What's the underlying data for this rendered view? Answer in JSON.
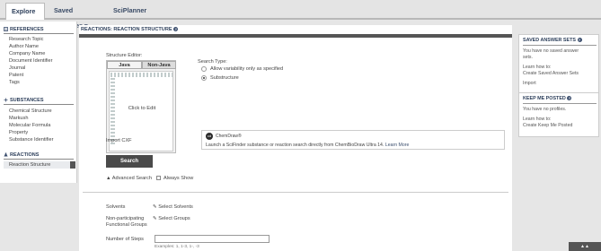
{
  "nav": {
    "tabs": [
      {
        "label": "Explore ▾"
      },
      {
        "label": "Saved Searches ▾"
      },
      {
        "label": "SciPlanner"
      }
    ]
  },
  "sidebar": {
    "references": {
      "title": "REFERENCES",
      "items": [
        "Research Topic",
        "Author Name",
        "Company Name",
        "Document Identifier",
        "Journal",
        "Patent",
        "Tags"
      ]
    },
    "substances": {
      "title": "SUBSTANCES",
      "items": [
        "Chemical Structure",
        "Markush",
        "Molecular Formula",
        "Property",
        "Substance Identifier"
      ]
    },
    "reactions": {
      "title": "REACTIONS",
      "items": [
        "Reaction Structure"
      ]
    }
  },
  "main": {
    "title": "REACTIONS: REACTION STRUCTURE",
    "structure_editor_label": "Structure Editor:",
    "editor_tabs": [
      "Java",
      "Non-Java"
    ],
    "click_to_edit": "Click to Edit",
    "search_type_label": "Search Type:",
    "search_types": [
      {
        "label": "Allow variability only as specified",
        "selected": false
      },
      {
        "label": "Substructure",
        "selected": true
      }
    ],
    "import_cxf": "Import CXF",
    "chemdraw": {
      "brand": "ChemDraw®",
      "text": "Launch a SciFinder substance or reaction search directly from ChemBioDraw Ultra 14.",
      "link": "Learn More"
    },
    "search_button": "Search",
    "advanced_search": "Advanced Search",
    "always_show": "Always Show",
    "solvents_label": "Solvents",
    "select_solvents": "Select Solvents",
    "nonparticipating_label": [
      "Non-participating",
      "Functional Groups"
    ],
    "select_groups": "Select Groups",
    "steps_label": "Number of Steps",
    "steps_value": "",
    "steps_examples": "Examples: 1, 1-3, 1-, -3"
  },
  "right": {
    "saved_answer_sets": {
      "title": "SAVED ANSWER SETS",
      "empty": [
        "You have no saved answer",
        "sets."
      ],
      "learn": "Learn how to:",
      "link": "Create Saved Answer Sets",
      "import": "Import"
    },
    "keep_me_posted": {
      "title": "KEEP ME POSTED",
      "empty": "You have no profiles.",
      "learn": "Learn how to:",
      "link": "Create Keep Me Posted"
    }
  }
}
